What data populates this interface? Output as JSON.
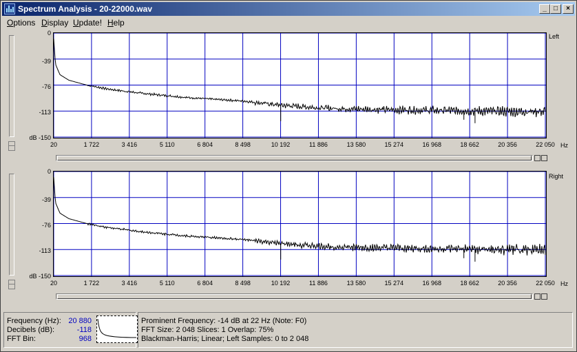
{
  "window": {
    "title": "Spectrum Analysis - 20-22000.wav",
    "controls": {
      "minimize": "_",
      "maximize": "□",
      "close": "×"
    }
  },
  "menu": [
    {
      "label": "Options",
      "accel": "O",
      "rest": "ptions"
    },
    {
      "label": "Display",
      "accel": "D",
      "rest": "isplay"
    },
    {
      "label": "Update!",
      "accel": "U",
      "rest": "pdate!"
    },
    {
      "label": "Help",
      "accel": "H",
      "rest": "elp"
    }
  ],
  "chart_data": [
    {
      "type": "line",
      "channel": "Left",
      "ylabels": [
        "0",
        "-39",
        "-76",
        "-113",
        "dB -150"
      ],
      "xlabels": [
        "20",
        "1 722",
        "3 416",
        "5 110",
        "6 804",
        "8 498",
        "10 192",
        "11 886",
        "13 580",
        "15 274",
        "16 968",
        "18 662",
        "20 356",
        "22 050"
      ],
      "xunit": "Hz",
      "xlim": [
        20,
        22050
      ],
      "ylim": [
        -150,
        0
      ],
      "grid": true,
      "series": [
        {
          "x": [
            20,
            100,
            300,
            700,
            1500,
            2500,
            4000,
            6000,
            8500,
            10192,
            12000,
            14000,
            16000,
            18000,
            20000,
            22050
          ],
          "y": [
            -8,
            -45,
            -60,
            -68,
            -75,
            -81,
            -87,
            -93,
            -98,
            -104,
            -108,
            -110,
            -111,
            -112,
            -113,
            -113
          ]
        }
      ],
      "dips": [
        {
          "x": 10192,
          "y": -127
        },
        {
          "x": 18400,
          "y": -125
        },
        {
          "x": 18900,
          "y": -130
        }
      ]
    },
    {
      "type": "line",
      "channel": "Right",
      "ylabels": [
        "0",
        "-39",
        "-76",
        "-113",
        "dB -150"
      ],
      "xlabels": [
        "20",
        "1 722",
        "3 416",
        "5 110",
        "6 804",
        "8 498",
        "10 192",
        "11 886",
        "13 580",
        "15 274",
        "16 968",
        "18 662",
        "20 356",
        "22 050"
      ],
      "xunit": "Hz",
      "xlim": [
        20,
        22050
      ],
      "ylim": [
        -150,
        0
      ],
      "grid": true,
      "series": [
        {
          "x": [
            20,
            100,
            300,
            700,
            1500,
            2500,
            4000,
            6000,
            8500,
            10192,
            12000,
            14000,
            16000,
            18000,
            20000,
            22050
          ],
          "y": [
            -8,
            -45,
            -60,
            -68,
            -75,
            -81,
            -87,
            -93,
            -98,
            -104,
            -108,
            -110,
            -111,
            -112,
            -113,
            -113
          ]
        }
      ],
      "dips": [
        {
          "x": 10192,
          "y": -127
        },
        {
          "x": 18400,
          "y": -125
        },
        {
          "x": 18900,
          "y": -130
        }
      ]
    }
  ],
  "status": {
    "frequency_label": "Frequency (Hz):",
    "frequency_value": "20 880",
    "decibels_label": "Decibels (dB):",
    "decibels_value": "-118",
    "fftbin_label": "FFT Bin:",
    "fftbin_value": "968",
    "prominent": "Prominent Frequency: -14 dB at 22 Hz (Note: F0)",
    "fft_line": "FFT Size: 2 048  Slices: 1  Overlap: 75%",
    "window_line": "Blackman-Harris; Linear; Left  Samples: 0 to 2 048"
  },
  "colors": {
    "grid": "#0000c0",
    "trace": "#000000",
    "plot_bg": "#ffffff",
    "value_text": "#0000c0"
  }
}
